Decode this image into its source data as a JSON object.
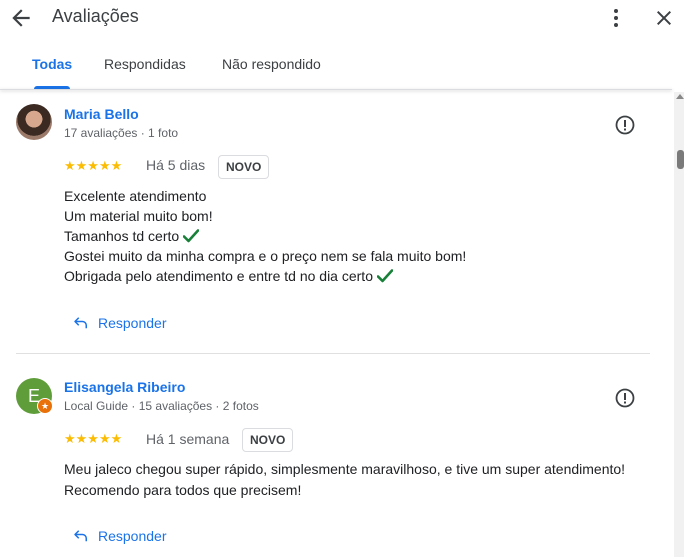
{
  "header": {
    "title": "Avaliações",
    "back_icon": "arrow-back-icon",
    "more_icon": "more-vert-icon",
    "close_icon": "close-icon"
  },
  "tabs": [
    {
      "label": "Todas",
      "active": true
    },
    {
      "label": "Respondidas",
      "active": false
    },
    {
      "label": "Não respondido",
      "active": false
    }
  ],
  "colors": {
    "accent": "#1a73e8",
    "star": "#fbbc04",
    "check": "#188038",
    "guide_badge": "#e8710a"
  },
  "reviews": [
    {
      "author": "Maria Bello",
      "meta": "17 avaliações · 1 foto",
      "rating": 5,
      "stars": "★★★★★",
      "when": "Há 5 dias",
      "badge": "NOVO",
      "lines": [
        "Excelente atendimento",
        "Um material muito bom!",
        "Tamanhos td certo",
        "Gostei muito da minha compra e o preço nem se fala muito bom!",
        "Obrigada pelo atendimento e entre td no dia certo"
      ],
      "reply_label": "Responder"
    },
    {
      "author": "Elisangela Ribeiro",
      "avatar_letter": "E",
      "meta": "Local Guide · 15 avaliações · 2 fotos",
      "rating": 5,
      "stars": "★★★★★",
      "when": "Há 1 semana",
      "badge": "NOVO",
      "lines": [
        "Meu jaleco chegou super rápido, simplesmente maravilhoso, e tive um super atendimento!",
        "Recomendo para todos que precisem!"
      ],
      "reply_label": "Responder"
    }
  ]
}
